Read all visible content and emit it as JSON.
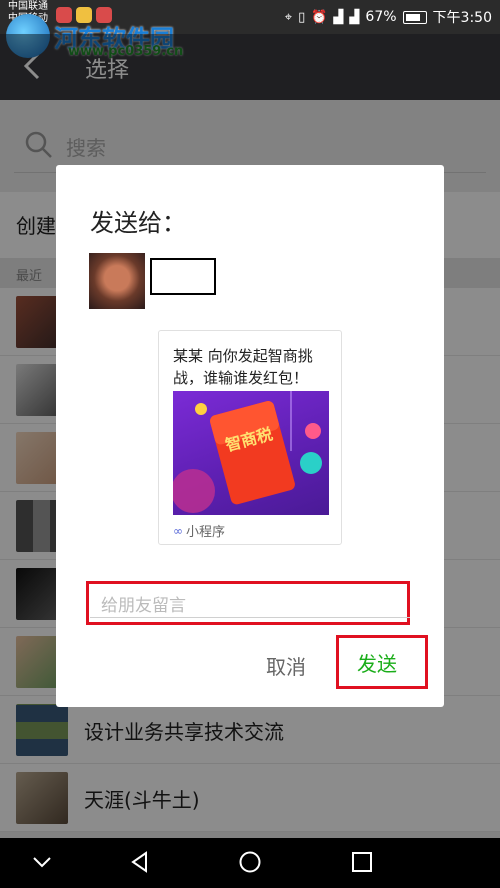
{
  "status_bar": {
    "carrier_1": "中国联通",
    "carrier_2": "中国移动",
    "battery": "67%",
    "time": "下午3:50"
  },
  "watermark": {
    "site_name": "河东软件园",
    "url": "www.pc0359.cn"
  },
  "app_bar": {
    "title": "选择"
  },
  "search": {
    "placeholder": "搜索"
  },
  "create_row": {
    "label": "创建"
  },
  "section": {
    "label": "最近"
  },
  "contacts": [
    {
      "name": ""
    },
    {
      "name": ""
    },
    {
      "name": ""
    },
    {
      "name": ""
    },
    {
      "name": ""
    },
    {
      "name": ""
    },
    {
      "name": "设计业务共享技术交流"
    },
    {
      "name": "天涯(斗牛土)"
    }
  ],
  "dialog": {
    "title": "发送给：",
    "card": {
      "text": "某某 向你发起智商挑战，谁输谁发红包！",
      "envelope_text": "智商税",
      "footer": "小程序"
    },
    "message_placeholder": "给朋友留言",
    "cancel_label": "取消",
    "send_label": "发送"
  },
  "colors": {
    "appbar": "#393a3f",
    "send_green": "#1aad19",
    "highlight_red": "#e01020",
    "card_purple": "#6a24c4"
  }
}
